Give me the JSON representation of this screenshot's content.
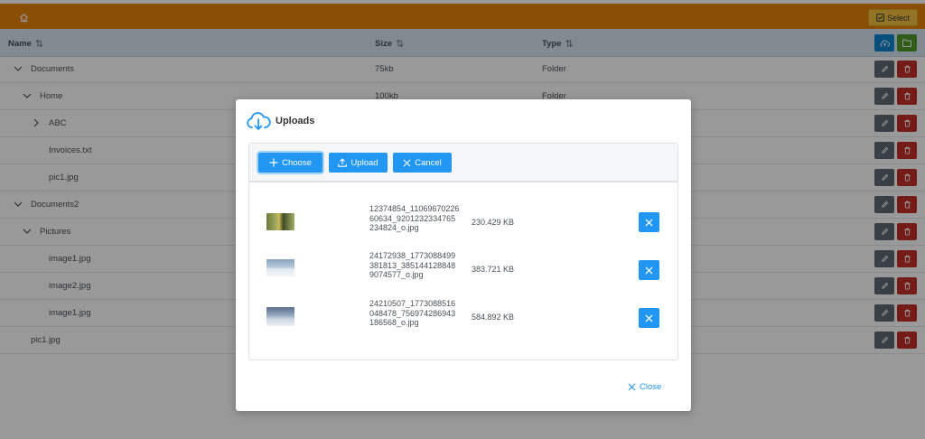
{
  "toolbar": {
    "select_label": "Select"
  },
  "table": {
    "headers": {
      "name": "Name",
      "size": "Size",
      "type": "Type"
    },
    "rows": [
      {
        "name": "Documents",
        "size": "75kb",
        "type": "Folder"
      },
      {
        "name": "Home",
        "size": "100kb",
        "type": "Folder"
      },
      {
        "name": "ABC",
        "size": "",
        "type": ""
      },
      {
        "name": "Invoices.txt",
        "size": "",
        "type": ""
      },
      {
        "name": "pic1.jpg",
        "size": "",
        "type": ""
      },
      {
        "name": "Documents2",
        "size": "",
        "type": ""
      },
      {
        "name": "Pictures",
        "size": "",
        "type": ""
      },
      {
        "name": "image1.jpg",
        "size": "",
        "type": ""
      },
      {
        "name": "image2.jpg",
        "size": "",
        "type": ""
      },
      {
        "name": "image1.jpg",
        "size": "",
        "type": ""
      },
      {
        "name": "pic1.jpg",
        "size": "",
        "type": ""
      }
    ]
  },
  "dialog": {
    "title": "Uploads",
    "choose_label": "Choose",
    "upload_label": "Upload",
    "cancel_label": "Cancel",
    "close_label": "Close",
    "files": [
      {
        "name": "12374854_1106967022660634_9201232334765234824_o.jpg",
        "size": "230.429 KB"
      },
      {
        "name": "24172938_1773088499381813_3851441288489074577_o.jpg",
        "size": "383.721 KB"
      },
      {
        "name": "24210507_1773088516048478_756974286943186568_o.jpg",
        "size": "584.892 KB"
      }
    ]
  },
  "colors": {
    "topbar": "#e8830c",
    "accent": "#2196f3",
    "delete": "#c4302b",
    "edit": "#5f6a72",
    "upload_header_btn": "#0b84d1",
    "folder_header_btn": "#4f9a2a"
  }
}
